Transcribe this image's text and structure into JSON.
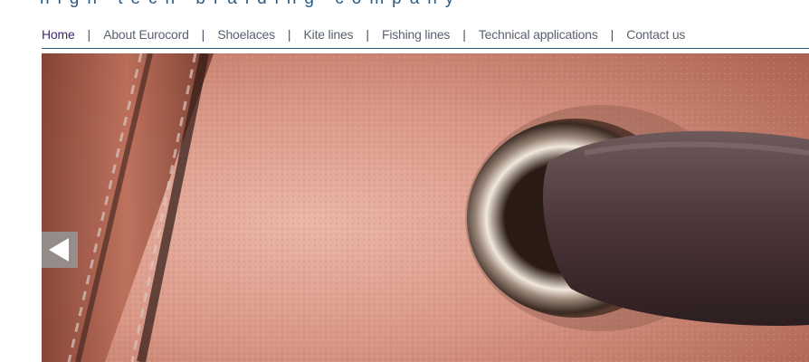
{
  "header": {
    "tagline": "high tech braiding company"
  },
  "nav": {
    "items": [
      {
        "label": "Home",
        "active": true
      },
      {
        "label": "About Eurocord"
      },
      {
        "label": "Shoelaces"
      },
      {
        "label": "Kite lines"
      },
      {
        "label": "Fishing lines"
      },
      {
        "label": "Technical applications"
      },
      {
        "label": "Contact us"
      }
    ],
    "separator": "|"
  },
  "slider": {
    "prev_icon": "triangle-left-icon"
  },
  "colors": {
    "nav_text": "#5a6270",
    "nav_active": "#3f2a6e",
    "rule": "#2f5f7e",
    "tagline": "#2b5c86"
  }
}
